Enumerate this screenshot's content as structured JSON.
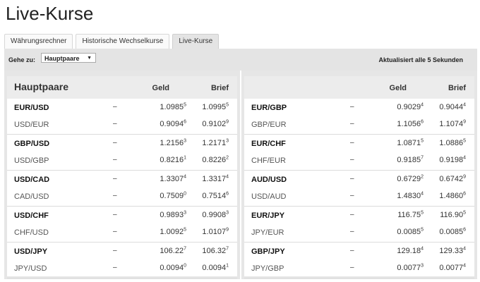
{
  "page": {
    "title": "Live-Kurse"
  },
  "tabs": [
    "Währungsrechner",
    "Historische Wechselkurse",
    "Live-Kurse"
  ],
  "toolbar": {
    "goto_label": "Gehe zu:",
    "select_value": "Hauptpaare",
    "updated_text": "Aktualisiert alle 5 Sekunden"
  },
  "panels": [
    {
      "title": "Hauptpaare",
      "col_geld": "Geld",
      "col_brief": "Brief",
      "groups": [
        {
          "rows": [
            {
              "pair": "EUR/USD",
              "geld": [
                "1.09",
                "85",
                "5"
              ],
              "brief": [
                "1.09",
                "95",
                "5"
              ]
            },
            {
              "pair": "USD/EUR",
              "geld": [
                "0.90",
                "94",
                "6"
              ],
              "brief": [
                "0.91",
                "02",
                "9"
              ]
            }
          ]
        },
        {
          "rows": [
            {
              "pair": "GBP/USD",
              "geld": [
                "1.21",
                "56",
                "3"
              ],
              "brief": [
                "1.21",
                "71",
                "3"
              ]
            },
            {
              "pair": "USD/GBP",
              "geld": [
                "0.82",
                "16",
                "1"
              ],
              "brief": [
                "0.82",
                "26",
                "2"
              ]
            }
          ]
        },
        {
          "rows": [
            {
              "pair": "USD/CAD",
              "geld": [
                "1.33",
                "07",
                "4"
              ],
              "brief": [
                "1.33",
                "17",
                "4"
              ]
            },
            {
              "pair": "CAD/USD",
              "geld": [
                "0.75",
                "09",
                "0"
              ],
              "brief": [
                "0.75",
                "14",
                "6"
              ]
            }
          ]
        },
        {
          "rows": [
            {
              "pair": "USD/CHF",
              "geld": [
                "0.98",
                "93",
                "3"
              ],
              "brief": [
                "0.99",
                "08",
                "3"
              ]
            },
            {
              "pair": "CHF/USD",
              "geld": [
                "1.00",
                "92",
                "5"
              ],
              "brief": [
                "1.01",
                "07",
                "9"
              ]
            }
          ]
        },
        {
          "rows": [
            {
              "pair": "USD/JPY",
              "geld": [
                "106.",
                "22",
                "7"
              ],
              "brief": [
                "106.",
                "32",
                "7"
              ]
            },
            {
              "pair": "JPY/USD",
              "geld": [
                "0.00",
                "94",
                "0"
              ],
              "brief": [
                "0.00",
                "94",
                "1"
              ]
            }
          ]
        }
      ]
    },
    {
      "title": "",
      "col_geld": "Geld",
      "col_brief": "Brief",
      "groups": [
        {
          "rows": [
            {
              "pair": "EUR/GBP",
              "geld": [
                "0.90",
                "29",
                "4"
              ],
              "brief": [
                "0.90",
                "44",
                "4"
              ]
            },
            {
              "pair": "GBP/EUR",
              "geld": [
                "1.10",
                "56",
                "6"
              ],
              "brief": [
                "1.10",
                "74",
                "9"
              ]
            }
          ]
        },
        {
          "rows": [
            {
              "pair": "EUR/CHF",
              "geld": [
                "1.08",
                "71",
                "5"
              ],
              "brief": [
                "1.08",
                "86",
                "5"
              ]
            },
            {
              "pair": "CHF/EUR",
              "geld": [
                "0.91",
                "85",
                "7"
              ],
              "brief": [
                "0.91",
                "98",
                "4"
              ]
            }
          ]
        },
        {
          "rows": [
            {
              "pair": "AUD/USD",
              "geld": [
                "0.67",
                "29",
                "2"
              ],
              "brief": [
                "0.67",
                "42",
                "9"
              ]
            },
            {
              "pair": "USD/AUD",
              "geld": [
                "1.48",
                "30",
                "4"
              ],
              "brief": [
                "1.48",
                "60",
                "6"
              ]
            }
          ]
        },
        {
          "rows": [
            {
              "pair": "EUR/JPY",
              "geld": [
                "116.",
                "75",
                "5"
              ],
              "brief": [
                "116.",
                "90",
                "5"
              ]
            },
            {
              "pair": "JPY/EUR",
              "geld": [
                "0.00",
                "85",
                "5"
              ],
              "brief": [
                "0.00",
                "85",
                "6"
              ]
            }
          ]
        },
        {
          "rows": [
            {
              "pair": "GBP/JPY",
              "geld": [
                "129.",
                "18",
                "4"
              ],
              "brief": [
                "129.",
                "33",
                "4"
              ]
            },
            {
              "pair": "JPY/GBP",
              "geld": [
                "0.00",
                "77",
                "3"
              ],
              "brief": [
                "0.00",
                "77",
                "4"
              ]
            }
          ]
        }
      ]
    }
  ],
  "dash": "–"
}
